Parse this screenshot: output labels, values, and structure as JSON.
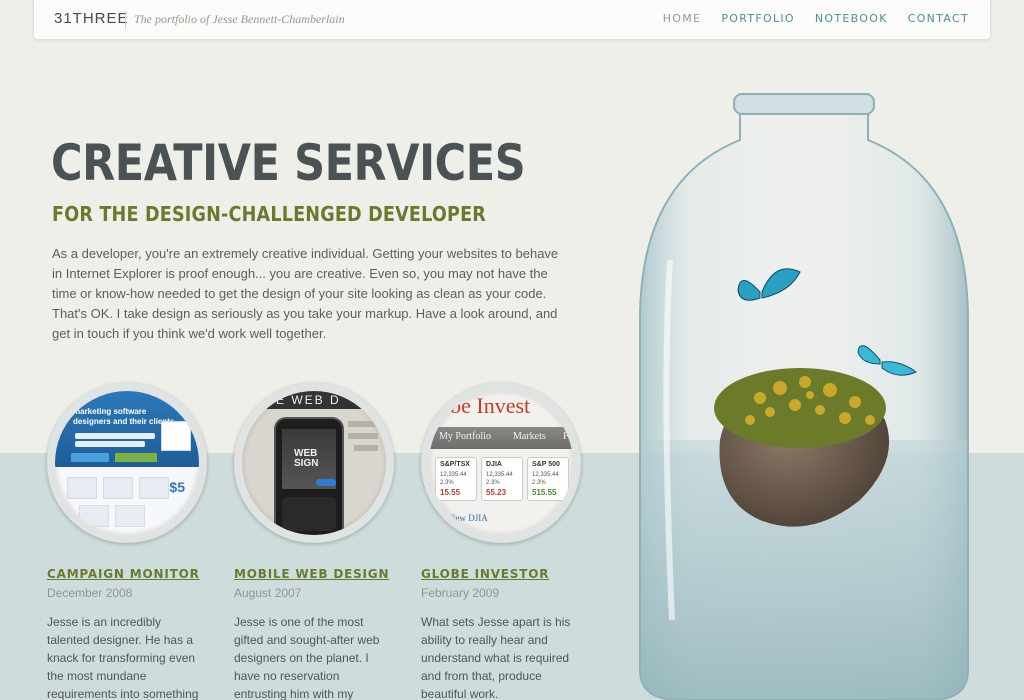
{
  "header": {
    "logo": "31THREE",
    "tagline": "The portfolio of Jesse Bennett-Chamberlain",
    "nav": [
      {
        "label": "HOME",
        "active": true
      },
      {
        "label": "PORTFOLIO",
        "active": false
      },
      {
        "label": "NOTEBOOK",
        "active": false
      },
      {
        "label": "CONTACT",
        "active": false
      }
    ]
  },
  "hero": {
    "title": "CREATIVE SERVICES",
    "subtitle": "FOR THE DESIGN-CHALLENGED DEVELOPER",
    "body": "As a developer, you're an extremely creative individual. Getting your websites to behave in Internet Explorer is proof enough... you are creative. Even so, you may not have the time or know-how needed to get the design of your site looking as clean as your code. That's OK. I take design as seriously as you take your markup. Have a look around, and get in touch if you think we'd work well together."
  },
  "projects": [
    {
      "title": "CAMPAIGN MONITOR",
      "date": "December 2008",
      "description": "Jesse is an incredibly talented designer. He has a knack for transforming even the most mundane requirements into something beautiful."
    },
    {
      "title": "MOBILE WEB DESIGN",
      "date": "August 2007",
      "description": "Jesse is one of the most gifted and sought-after web designers on the planet. I have no reservation entrusting him with my projects."
    },
    {
      "title": "GLOBE INVESTOR",
      "date": "February 2009",
      "description": "What sets Jesse apart is his ability to really hear and understand what is required and from that, produce beautiful work."
    }
  ],
  "thumbs": {
    "campaign": {
      "headline": "marketing software designers and their clients",
      "five": "$5"
    },
    "mobile": {
      "book_title": "E WEB D",
      "screen_text": "WEB SIGN"
    },
    "globe": {
      "brand": "lobe Invest",
      "tabs": [
        "My Portfolio",
        "Markets",
        "Fu"
      ],
      "boxes": [
        {
          "label": "S&P/TSX",
          "value": "12,335.44",
          "pct": "2.3%",
          "change": "15.55",
          "direction": "down"
        },
        {
          "label": "DJIA",
          "value": "12,335.44",
          "pct": "2.3%",
          "change": "55.23",
          "direction": "down"
        },
        {
          "label": "S&P 500",
          "value": "12,335.44",
          "pct": "2.3%",
          "change": "515.55",
          "direction": "up"
        }
      ],
      "view_link": "View DJIA"
    }
  },
  "colors": {
    "background": "#efefea",
    "band": "#cfdcdc",
    "nav_link": "#4f8e96",
    "nav_active": "#9a9a94",
    "title": "#4a5253",
    "accent_green": "#6a7a2d"
  }
}
